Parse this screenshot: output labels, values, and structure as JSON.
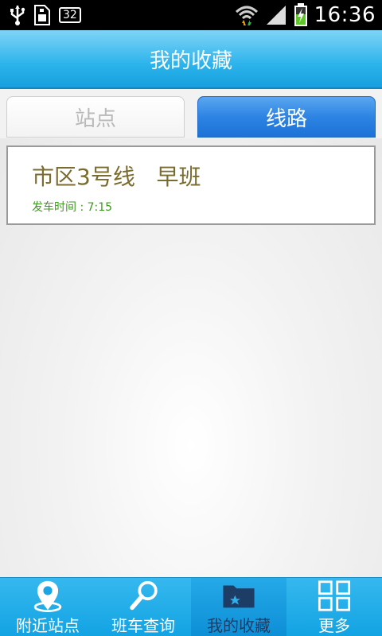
{
  "status_bar": {
    "notification_badge": "32",
    "time": "16:36",
    "icons": [
      "usb-icon",
      "sim-card-icon",
      "wifi-icon",
      "signal-icon",
      "battery-charging-icon"
    ]
  },
  "header": {
    "title": "我的收藏"
  },
  "tabs": [
    {
      "label": "站点",
      "selected": false
    },
    {
      "label": "线路",
      "selected": true
    }
  ],
  "favorites": [
    {
      "title": "市区3号线   早班",
      "subtitle": "发车时间 : 7:15"
    }
  ],
  "bottom_nav": [
    {
      "label": "附近站点",
      "icon": "location-pin-icon",
      "selected": false
    },
    {
      "label": "班车查询",
      "icon": "search-icon",
      "selected": false
    },
    {
      "label": "我的收藏",
      "icon": "star-folder-icon",
      "selected": true
    },
    {
      "label": "更多",
      "icon": "grid-icon",
      "selected": false
    }
  ],
  "colors": {
    "header": "#2bb3ec",
    "active_tab": "#2d84e3",
    "route_title": "#7a6c2e",
    "route_time": "#3c9a1c",
    "bottom_nav": "#12a3e3",
    "active_nav_label": "#1d3d66"
  }
}
